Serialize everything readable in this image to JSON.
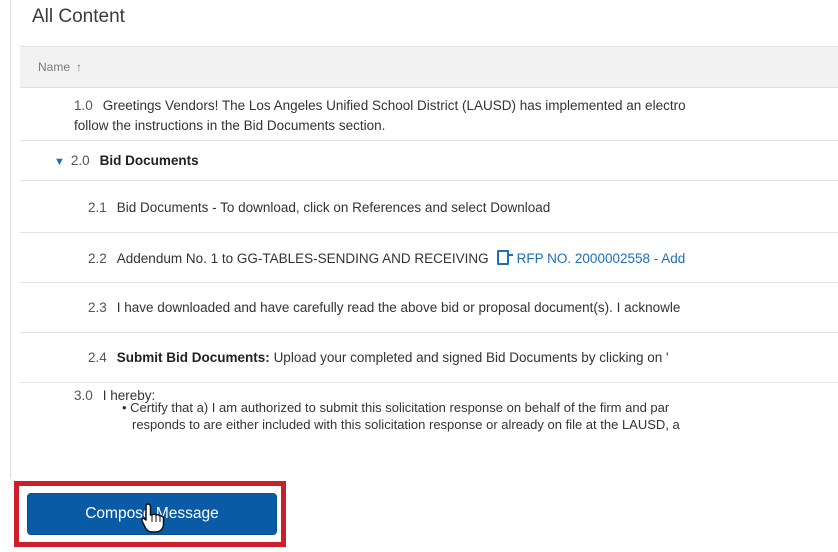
{
  "section": {
    "title": "All Content"
  },
  "table": {
    "column_header": "Name",
    "sort_icon": "↑"
  },
  "rows": [
    {
      "number": "1.0",
      "text": "Greetings Vendors! The Los Angeles Unified School District (LAUSD) has implemented an electro",
      "text2": "follow the instructions in the Bid Documents section."
    },
    {
      "number": "2.0",
      "text": "Bid Documents"
    },
    {
      "number": "2.1",
      "text": "Bid Documents - To download, click on References and select Download"
    },
    {
      "number": "2.2",
      "text": "Addendum No. 1 to GG-TABLES-SENDING AND RECEIVING",
      "link": "RFP NO. 2000002558 - Add"
    },
    {
      "number": "2.3",
      "text": "I have downloaded and have carefully read the above bid or proposal document(s). I acknowle"
    },
    {
      "number": "2.4",
      "bold": "Submit Bid Documents:",
      "text": "Upload your completed and signed Bid Documents by clicking on '"
    },
    {
      "number": "3.0",
      "text": "I hereby:"
    }
  ],
  "bullet": {
    "line1": "• Certify that a) I am authorized to submit this solicitation response on behalf of the firm and par",
    "line2": "responds to are either included with this solicitation response or already on file at the LAUSD, a"
  },
  "footer": {
    "compose_label": "Compose Message"
  },
  "icons": {
    "sort": "arrow-up-icon",
    "expand": "caret-down-icon",
    "attachment": "document-icon",
    "cursor": "hand-pointer-icon"
  },
  "colors": {
    "primary": "#0a5ba6",
    "link": "#1f6fb5",
    "highlight": "#cc1f2a"
  }
}
